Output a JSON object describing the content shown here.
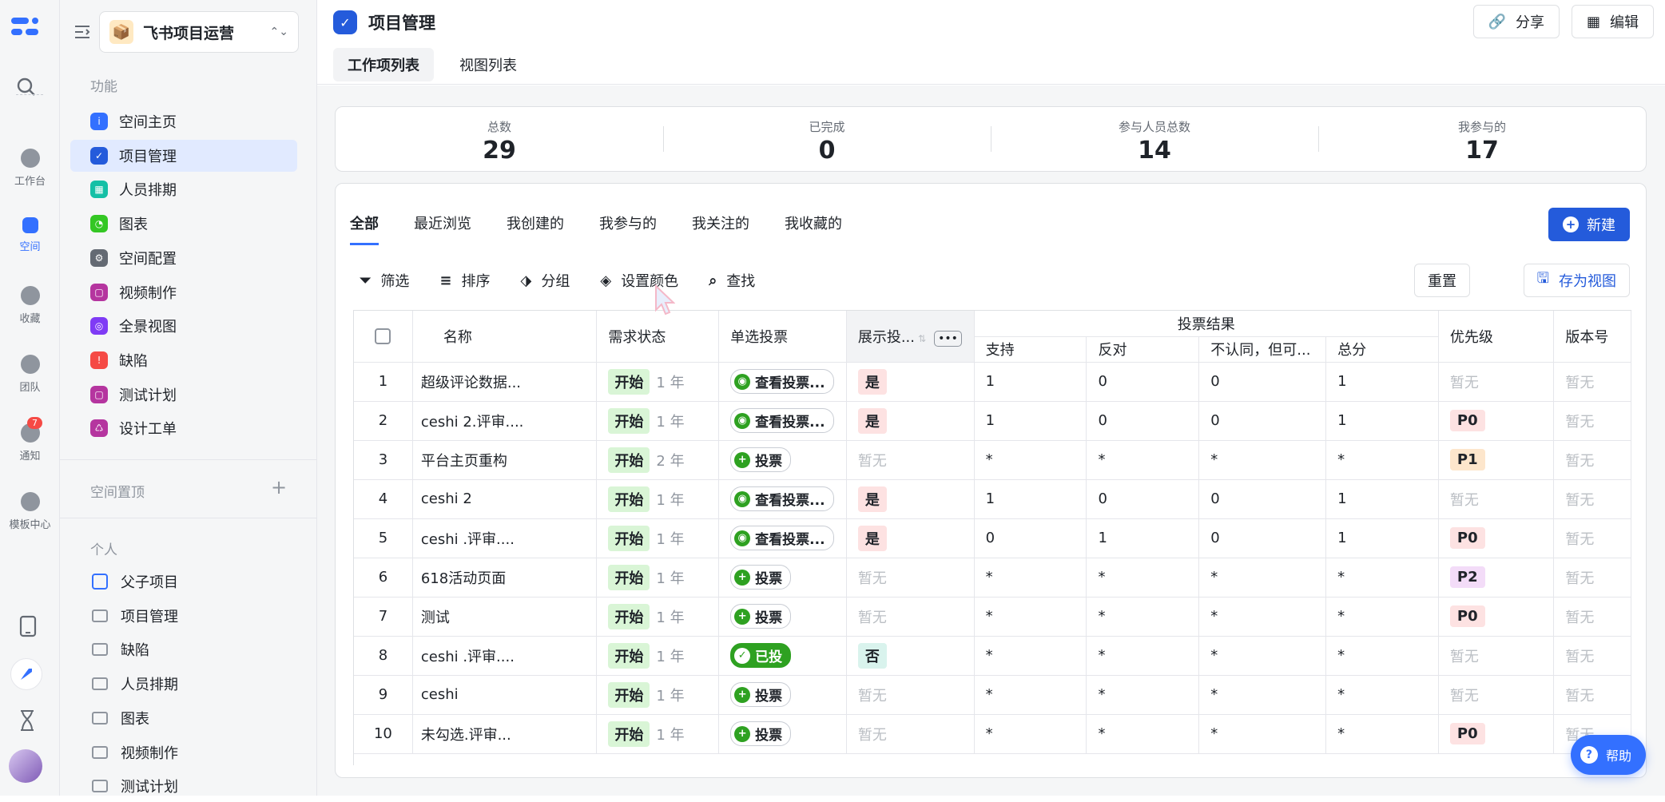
{
  "rail": {
    "items": [
      {
        "label": "工作台",
        "icon": "home-icon"
      },
      {
        "label": "空间",
        "icon": "space-icon"
      },
      {
        "label": "收藏",
        "icon": "star-icon"
      },
      {
        "label": "团队",
        "icon": "team-icon"
      },
      {
        "label": "通知",
        "icon": "bell-icon",
        "badge": "7"
      },
      {
        "label": "模板中心",
        "icon": "template-icon"
      }
    ]
  },
  "sidebar": {
    "workspace_name": "飞书项目运营",
    "section_features": "功能",
    "features": [
      {
        "label": "空间主页",
        "color": "#3370ff",
        "glyph": "i"
      },
      {
        "label": "项目管理",
        "color": "#245bdb",
        "glyph": "✓"
      },
      {
        "label": "人员排期",
        "color": "#14c0a6",
        "glyph": "▦"
      },
      {
        "label": "图表",
        "color": "#34c724",
        "glyph": "◔"
      },
      {
        "label": "空间配置",
        "color": "#646a73",
        "glyph": "⚙"
      },
      {
        "label": "视频制作",
        "color": "#b5359f",
        "glyph": "▢"
      },
      {
        "label": "全景视图",
        "color": "#7f3bf5",
        "glyph": "◎"
      },
      {
        "label": "缺陷",
        "color": "#f54a45",
        "glyph": "!"
      },
      {
        "label": "测试计划",
        "color": "#b5359f",
        "glyph": "▢"
      },
      {
        "label": "设计工单",
        "color": "#b5359f",
        "glyph": "♺"
      }
    ],
    "section_pinned": "空间置顶",
    "section_personal": "个人",
    "personal": [
      "父子项目",
      "项目管理",
      "缺陷",
      "人员排期",
      "图表",
      "视频制作",
      "测试计划"
    ]
  },
  "header": {
    "title": "项目管理",
    "share_label": "分享",
    "edit_label": "编辑",
    "tabs": [
      "工作项列表",
      "视图列表"
    ]
  },
  "stats": [
    {
      "label": "总数",
      "value": "29"
    },
    {
      "label": "已完成",
      "value": "0"
    },
    {
      "label": "参与人员总数",
      "value": "14"
    },
    {
      "label": "我参与的",
      "value": "17"
    }
  ],
  "filter_tabs": [
    "全部",
    "最近浏览",
    "我创建的",
    "我参与的",
    "我关注的",
    "我收藏的"
  ],
  "new_label": "新建",
  "toolbar": {
    "filter": "筛选",
    "sort": "排序",
    "group": "分组",
    "color": "设置颜色",
    "find": "查找",
    "reset": "重置",
    "save_view": "存为视图"
  },
  "table": {
    "headers": {
      "name": "名称",
      "status": "需求状态",
      "vote": "单选投票",
      "show": "展示投...",
      "vote_result": "投票结果",
      "support": "支持",
      "oppose": "反对",
      "disagree": "不认同，但可...",
      "total": "总分",
      "priority": "优先级",
      "version": "版本号"
    },
    "rows": [
      {
        "idx": "1",
        "name": "超级评论数据...",
        "status": "开始",
        "age": "1 年",
        "vote": "查看投票...",
        "vote_type": "view",
        "show": "是",
        "support": "1",
        "oppose": "0",
        "disagree": "0",
        "total": "1",
        "priority": "暂无",
        "version": "暂无"
      },
      {
        "idx": "2",
        "name": "ceshi 2.评审....",
        "status": "开始",
        "age": "1 年",
        "vote": "查看投票...",
        "vote_type": "view",
        "show": "是",
        "support": "1",
        "oppose": "0",
        "disagree": "0",
        "total": "1",
        "priority": "P0",
        "version": "暂无"
      },
      {
        "idx": "3",
        "name": "平台主页重构",
        "status": "开始",
        "age": "2 年",
        "vote": "投票",
        "vote_type": "add",
        "show": "暂无",
        "support": "*",
        "oppose": "*",
        "disagree": "*",
        "total": "*",
        "priority": "P1",
        "version": "暂无"
      },
      {
        "idx": "4",
        "name": "ceshi 2",
        "status": "开始",
        "age": "1 年",
        "vote": "查看投票...",
        "vote_type": "view",
        "show": "是",
        "support": "1",
        "oppose": "0",
        "disagree": "0",
        "total": "1",
        "priority": "暂无",
        "version": "暂无"
      },
      {
        "idx": "5",
        "name": "ceshi .评审....",
        "status": "开始",
        "age": "1 年",
        "vote": "查看投票...",
        "vote_type": "view",
        "show": "是",
        "support": "0",
        "oppose": "1",
        "disagree": "0",
        "total": "1",
        "priority": "P0",
        "version": "暂无"
      },
      {
        "idx": "6",
        "name": "618活动页面",
        "status": "开始",
        "age": "1 年",
        "vote": "投票",
        "vote_type": "add",
        "show": "暂无",
        "support": "*",
        "oppose": "*",
        "disagree": "*",
        "total": "*",
        "priority": "P2",
        "version": "暂无"
      },
      {
        "idx": "7",
        "name": "测试",
        "status": "开始",
        "age": "1 年",
        "vote": "投票",
        "vote_type": "add",
        "show": "暂无",
        "support": "*",
        "oppose": "*",
        "disagree": "*",
        "total": "*",
        "priority": "P0",
        "version": "暂无"
      },
      {
        "idx": "8",
        "name": "ceshi .评审....",
        "status": "开始",
        "age": "1 年",
        "vote": "已投",
        "vote_type": "done",
        "show": "否",
        "support": "*",
        "oppose": "*",
        "disagree": "*",
        "total": "*",
        "priority": "暂无",
        "version": "暂无"
      },
      {
        "idx": "9",
        "name": "ceshi",
        "status": "开始",
        "age": "1 年",
        "vote": "投票",
        "vote_type": "add",
        "show": "暂无",
        "support": "*",
        "oppose": "*",
        "disagree": "*",
        "total": "*",
        "priority": "暂无",
        "version": "暂无"
      },
      {
        "idx": "10",
        "name": "未勾选.评审...",
        "status": "开始",
        "age": "1 年",
        "vote": "投票",
        "vote_type": "add",
        "show": "暂无",
        "support": "*",
        "oppose": "*",
        "disagree": "*",
        "total": "*",
        "priority": "P0",
        "version": "暂无"
      }
    ]
  },
  "help_label": "帮助",
  "colors": {
    "accent": "#245bdb",
    "green": "#2ea121"
  }
}
